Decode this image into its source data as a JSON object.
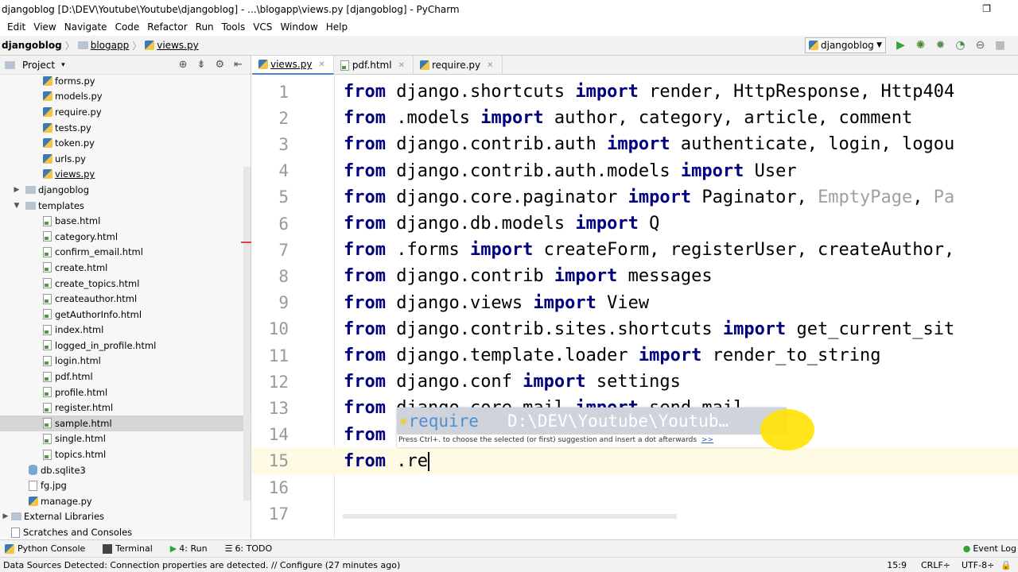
{
  "window": {
    "title": "djangoblog [D:\\DEV\\Youtube\\Youtube\\djangoblog] - ...\\blogapp\\views.py [djangoblog] - PyCharm",
    "restore_glyph": "❐"
  },
  "menu": [
    "Edit",
    "View",
    "Navigate",
    "Code",
    "Refactor",
    "Run",
    "Tools",
    "VCS",
    "Window",
    "Help"
  ],
  "breadcrumb": [
    "djangoblog",
    "blogapp",
    "views.py"
  ],
  "run_config": {
    "label": "djangoblog"
  },
  "project_panel": {
    "label": "Project",
    "dropdown": "▾"
  },
  "tree": [
    {
      "label": "forms.py",
      "type": "py",
      "depth": 3
    },
    {
      "label": "models.py",
      "type": "py",
      "depth": 3
    },
    {
      "label": "require.py",
      "type": "py",
      "depth": 3
    },
    {
      "label": "tests.py",
      "type": "py",
      "depth": 3
    },
    {
      "label": "token.py",
      "type": "py",
      "depth": 3
    },
    {
      "label": "urls.py",
      "type": "py",
      "depth": 3
    },
    {
      "label": "views.py",
      "type": "py",
      "depth": 3
    },
    {
      "label": "djangoblog",
      "type": "folder",
      "depth": 2,
      "arrow": "▶"
    },
    {
      "label": "templates",
      "type": "folder",
      "depth": 2,
      "arrow": "▼"
    },
    {
      "label": "base.html",
      "type": "html",
      "depth": 3
    },
    {
      "label": "category.html",
      "type": "html",
      "depth": 3
    },
    {
      "label": "confirm_email.html",
      "type": "html",
      "depth": 3
    },
    {
      "label": "create.html",
      "type": "html",
      "depth": 3
    },
    {
      "label": "create_topics.html",
      "type": "html",
      "depth": 3
    },
    {
      "label": "createauthor.html",
      "type": "html",
      "depth": 3
    },
    {
      "label": "getAuthorInfo.html",
      "type": "html",
      "depth": 3
    },
    {
      "label": "index.html",
      "type": "html",
      "depth": 3
    },
    {
      "label": "logged_in_profile.html",
      "type": "html",
      "depth": 3
    },
    {
      "label": "login.html",
      "type": "html",
      "depth": 3
    },
    {
      "label": "pdf.html",
      "type": "html",
      "depth": 3
    },
    {
      "label": "profile.html",
      "type": "html",
      "depth": 3
    },
    {
      "label": "register.html",
      "type": "html",
      "depth": 3
    },
    {
      "label": "sample.html",
      "type": "html",
      "depth": 3,
      "selected": true
    },
    {
      "label": "single.html",
      "type": "html",
      "depth": 3
    },
    {
      "label": "topics.html",
      "type": "html",
      "depth": 3
    },
    {
      "label": "db.sqlite3",
      "type": "db",
      "depth": 2
    },
    {
      "label": "fg.jpg",
      "type": "img",
      "depth": 2
    },
    {
      "label": "manage.py",
      "type": "py",
      "depth": 2
    },
    {
      "label": "External Libraries",
      "type": "lib",
      "depth": 0,
      "arrow": "▶"
    },
    {
      "label": "Scratches and Consoles",
      "type": "scratch",
      "depth": 0
    }
  ],
  "tabs": [
    {
      "label": "views.py",
      "active": true,
      "icon": "py"
    },
    {
      "label": "pdf.html",
      "active": false,
      "icon": "html"
    },
    {
      "label": "require.py",
      "active": false,
      "icon": "py"
    }
  ],
  "code": [
    [
      [
        "kw",
        "from"
      ],
      [
        "id",
        " django.shortcuts "
      ],
      [
        "kw",
        "import"
      ],
      [
        "id",
        " render, HttpResponse, Http404"
      ]
    ],
    [
      [
        "kw",
        "from"
      ],
      [
        "id",
        " .models "
      ],
      [
        "kw",
        "import"
      ],
      [
        "id",
        " author, category, article, comment"
      ]
    ],
    [
      [
        "kw",
        "from"
      ],
      [
        "id",
        " django.contrib.auth "
      ],
      [
        "kw",
        "import"
      ],
      [
        "id",
        " authenticate, login, logou"
      ]
    ],
    [
      [
        "kw",
        "from"
      ],
      [
        "id",
        " django.contrib.auth.models "
      ],
      [
        "kw",
        "import"
      ],
      [
        "id",
        " User"
      ]
    ],
    [
      [
        "kw",
        "from"
      ],
      [
        "id",
        " django.core.paginator "
      ],
      [
        "kw",
        "import"
      ],
      [
        "id",
        " Paginator, "
      ],
      [
        "gray",
        "EmptyPage"
      ],
      [
        "id",
        ", "
      ],
      [
        "gray",
        "Pa"
      ]
    ],
    [
      [
        "kw",
        "from"
      ],
      [
        "id",
        " django.db.models "
      ],
      [
        "kw",
        "import"
      ],
      [
        "id",
        " Q"
      ]
    ],
    [
      [
        "kw",
        "from"
      ],
      [
        "id",
        " .forms "
      ],
      [
        "kw",
        "import"
      ],
      [
        "id",
        " createForm, registerUser, createAuthor,"
      ]
    ],
    [
      [
        "kw",
        "from"
      ],
      [
        "id",
        " django.contrib "
      ],
      [
        "kw",
        "import"
      ],
      [
        "id",
        " messages"
      ]
    ],
    [
      [
        "kw",
        "from"
      ],
      [
        "id",
        " django.views "
      ],
      [
        "kw",
        "import"
      ],
      [
        "id",
        " View"
      ]
    ],
    [
      [
        "kw",
        "from"
      ],
      [
        "id",
        " django.contrib.sites.shortcuts "
      ],
      [
        "kw",
        "import"
      ],
      [
        "id",
        " get_current_sit"
      ]
    ],
    [
      [
        "kw",
        "from"
      ],
      [
        "id",
        " django.template.loader "
      ],
      [
        "kw",
        "import"
      ],
      [
        "id",
        " render_to_string"
      ]
    ],
    [
      [
        "kw",
        "from"
      ],
      [
        "id",
        " django.conf "
      ],
      [
        "kw",
        "import"
      ],
      [
        "id",
        " settings"
      ]
    ],
    [
      [
        "kw",
        "from"
      ],
      [
        "id",
        " django.core.mail "
      ],
      [
        "kw",
        "import"
      ],
      [
        "id",
        " send_mail"
      ]
    ],
    [
      [
        "kw",
        "from"
      ]
    ],
    [
      [
        "kw",
        "from"
      ],
      [
        "id",
        " .re"
      ]
    ],
    [],
    []
  ],
  "line_numbers": [
    "1",
    "2",
    "3",
    "4",
    "5",
    "6",
    "7",
    "8",
    "9",
    "10",
    "11",
    "12",
    "13",
    "14",
    "15",
    "16",
    "17"
  ],
  "autocomplete": {
    "suggestion": "require",
    "path": "D:\\DEV\\Youtube\\Youtub…",
    "hint": "Press Ctrl+. to choose the selected (or first) suggestion and insert a dot afterwards",
    "hint_link": ">>"
  },
  "toolwindows": [
    "Python Console",
    "Terminal",
    "4: Run",
    "6: TODO"
  ],
  "event_log": "Event Log",
  "status": {
    "message": "Data Sources Detected: Connection properties are detected. // Configure (27 minutes ago)",
    "position": "15:9",
    "line_sep": "CRLF÷",
    "encoding": "UTF-8÷"
  }
}
